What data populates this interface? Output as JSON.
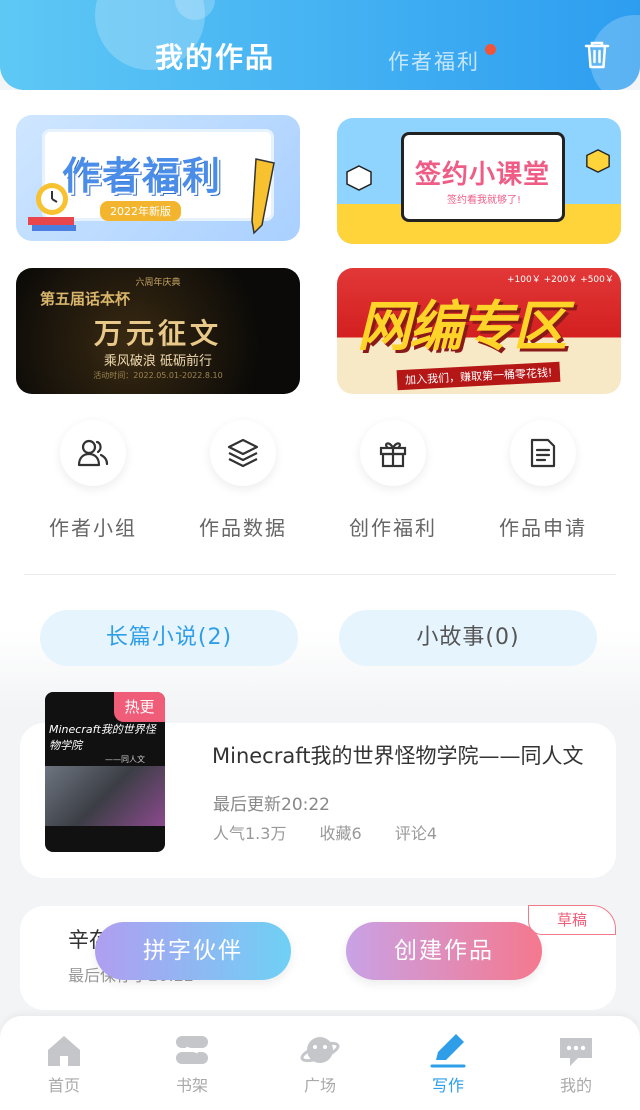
{
  "header": {
    "title": "我的作品",
    "welfare_link": "作者福利"
  },
  "banners": {
    "welfare": {
      "title": "作者福利",
      "subtitle": "2022年新版"
    },
    "class": {
      "title": "签约小课堂",
      "subtitle": "签约看我就够了!"
    },
    "contest": {
      "top": "六周年庆典",
      "title1": "第五届话本杯",
      "title2": "万元征文",
      "subtitle": "乘风破浪 砥砺前行",
      "date": "活动时间：2022.05.01-2022.8.10"
    },
    "zone": {
      "title": "网编专区",
      "strip": "加入我们，赚取第一桶零花钱!",
      "money": "+100￥ +200￥ +500￥"
    }
  },
  "quick_actions": [
    {
      "label": "作者小组",
      "icon": "group-icon"
    },
    {
      "label": "作品数据",
      "icon": "layers-icon"
    },
    {
      "label": "创作福利",
      "icon": "gift-icon"
    },
    {
      "label": "作品申请",
      "icon": "document-icon"
    }
  ],
  "tabs": {
    "long": "长篇小说(2)",
    "short": "小故事(0)"
  },
  "book": {
    "badge": "热更",
    "cover_text": "Minecraft我的世界怪物学院",
    "cover_author": "——同人文",
    "title": "Minecraft我的世界怪物学院——同人文",
    "update": "最后更新20:22",
    "popularity": "人气1.3万",
    "favorites": "收藏6",
    "comments": "评论4"
  },
  "draft": {
    "tag": "草稿",
    "title": "辛存",
    "subtitle": "最后保存于20:22"
  },
  "buttons": {
    "partner": "拼字伙伴",
    "create": "创建作品"
  },
  "nav": [
    {
      "label": "首页",
      "icon": "home-icon",
      "active": false
    },
    {
      "label": "书架",
      "icon": "bookshelf-icon",
      "active": false
    },
    {
      "label": "广场",
      "icon": "planet-icon",
      "active": false
    },
    {
      "label": "写作",
      "icon": "pen-icon",
      "active": true
    },
    {
      "label": "我的",
      "icon": "chat-icon",
      "active": false
    }
  ],
  "colors": {
    "accent": "#2f9ee8",
    "header_start": "#5ec8f5",
    "header_end": "#2d9df0",
    "hot": "#f05d78"
  }
}
